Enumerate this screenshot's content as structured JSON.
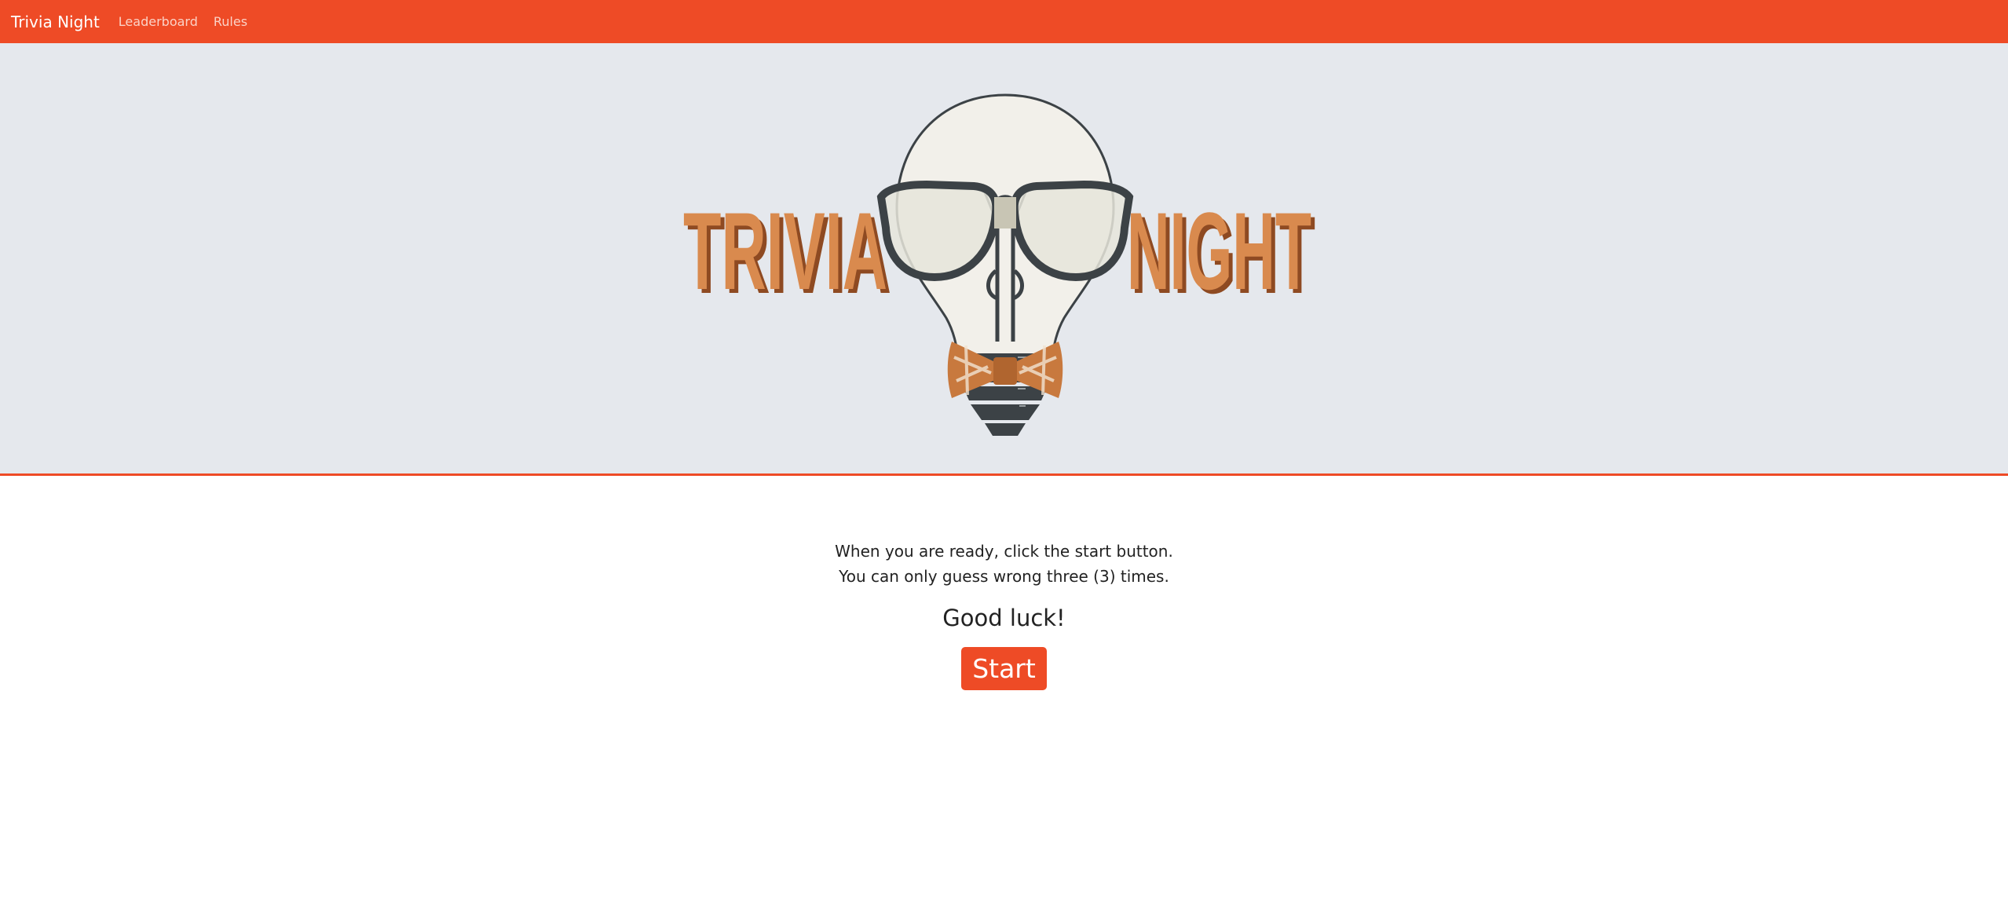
{
  "navbar": {
    "brand": "Trivia Night",
    "links": [
      "Leaderboard",
      "Rules"
    ]
  },
  "hero": {
    "logo_word_left": "TRIVIA",
    "logo_word_right": "NIGHT",
    "logo_colors": {
      "letters": "#c8793e",
      "letters_shadow": "#8e4a22",
      "bulb": "#f2f0ea",
      "glasses": "#3c4246",
      "bowtie": "#c8793e"
    }
  },
  "content": {
    "instruction_line1": "When you are ready, click the start button.",
    "instruction_line2": "You can only guess wrong three (3) times.",
    "good_luck": "Good luck!",
    "start_label": "Start"
  },
  "colors": {
    "accent": "#ee4b26",
    "hero_bg": "#e5e8ed"
  }
}
